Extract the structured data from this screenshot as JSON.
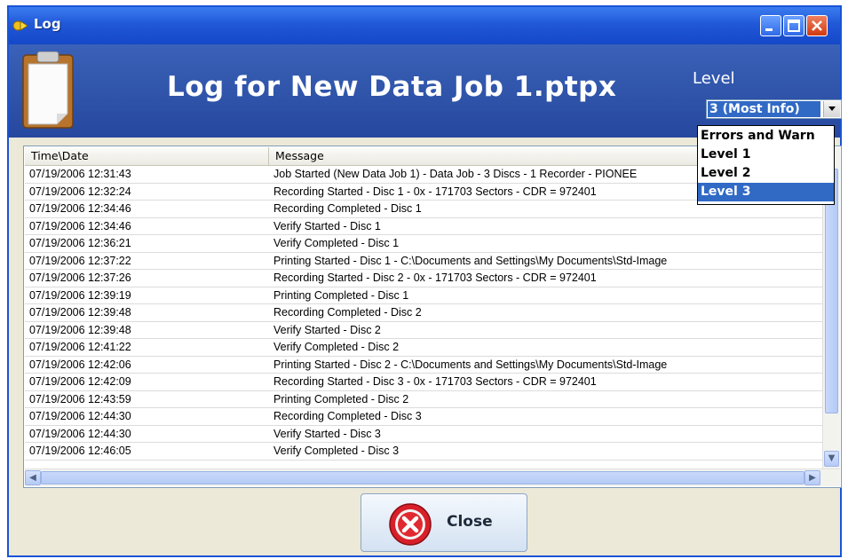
{
  "window": {
    "title": "Log"
  },
  "header": {
    "title": "Log for New Data Job 1.ptpx",
    "level_label": "Level",
    "level_selected": "3 (Most Info)"
  },
  "dropdown": {
    "options": [
      "Errors and Warn",
      "Level 1",
      "Level 2",
      "Level 3"
    ],
    "selected_index": 3
  },
  "log": {
    "columns": [
      "Time\\Date",
      "Message"
    ],
    "rows": [
      [
        "07/19/2006 12:31:43",
        "Job Started  (New Data Job 1) - Data Job - 3 Discs - 1 Recorder - PIONEE"
      ],
      [
        "07/19/2006 12:32:24",
        "Recording Started - Disc 1 - 0x - 171703 Sectors - CDR = 972401"
      ],
      [
        "07/19/2006 12:34:46",
        "Recording Completed - Disc 1"
      ],
      [
        "07/19/2006 12:34:46",
        "Verify Started - Disc 1"
      ],
      [
        "07/19/2006 12:36:21",
        "Verify Completed - Disc 1"
      ],
      [
        "07/19/2006 12:37:22",
        "Printing Started - Disc 1  -  C:\\Documents and Settings\\My Documents\\Std-Image"
      ],
      [
        "07/19/2006 12:37:26",
        "Recording Started - Disc 2 - 0x - 171703 Sectors - CDR = 972401"
      ],
      [
        "07/19/2006 12:39:19",
        "Printing Completed - Disc 1"
      ],
      [
        "07/19/2006 12:39:48",
        "Recording Completed - Disc 2"
      ],
      [
        "07/19/2006 12:39:48",
        "Verify Started - Disc 2"
      ],
      [
        "07/19/2006 12:41:22",
        "Verify Completed - Disc 2"
      ],
      [
        "07/19/2006 12:42:06",
        "Printing Started - Disc 2  -  C:\\Documents and Settings\\My Documents\\Std-Image"
      ],
      [
        "07/19/2006 12:42:09",
        "Recording Started - Disc 3 - 0x - 171703 Sectors - CDR = 972401"
      ],
      [
        "07/19/2006 12:43:59",
        "Printing Completed - Disc 2"
      ],
      [
        "07/19/2006 12:44:30",
        "Recording Completed - Disc 3"
      ],
      [
        "07/19/2006 12:44:30",
        "Verify Started - Disc 3"
      ],
      [
        "07/19/2006 12:46:05",
        "Verify Completed - Disc 3"
      ]
    ]
  },
  "footer": {
    "close_label": "Close"
  },
  "colors": {
    "title_bar": "#2058d8",
    "header_bg": "#2f55aa",
    "selection": "#316ac5",
    "close_icon": "#d8202a"
  },
  "icons": [
    "log-app-icon",
    "clipboard-icon",
    "minimize-icon",
    "maximize-icon",
    "close-window-icon",
    "dropdown-arrow-icon",
    "close-x-icon"
  ]
}
